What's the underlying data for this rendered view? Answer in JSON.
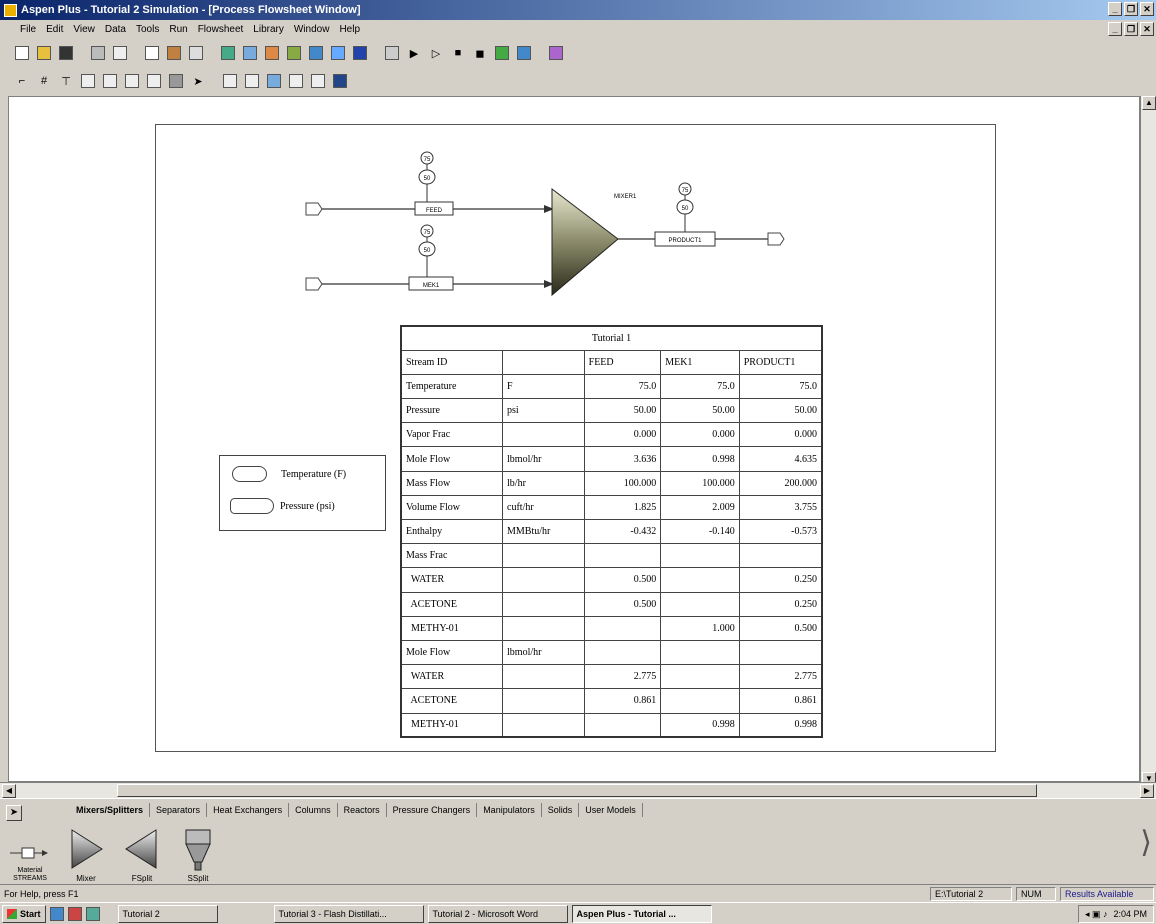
{
  "window": {
    "title": "Aspen Plus - Tutorial 2 Simulation - [Process Flowsheet Window]"
  },
  "menu": [
    "File",
    "Edit",
    "View",
    "Data",
    "Tools",
    "Run",
    "Flowsheet",
    "Library",
    "Window",
    "Help"
  ],
  "flowsheet": {
    "block_name": "MIXER1",
    "streams": [
      {
        "id": "FEED",
        "temp": "75",
        "pressure": "50"
      },
      {
        "id": "MEK1",
        "temp": "75",
        "pressure": "50"
      },
      {
        "id": "PRODUCT1",
        "temp": "75",
        "pressure": "50"
      }
    ]
  },
  "legend": {
    "temperature": "Temperature (F)",
    "pressure": "Pressure (psi)"
  },
  "results_table": {
    "title": "Tutorial 1",
    "header": [
      "Stream ID",
      "",
      "FEED",
      "MEK1",
      "PRODUCT1"
    ],
    "rows": [
      [
        "Temperature",
        "F",
        "75.0",
        "75.0",
        "75.0"
      ],
      [
        "Pressure",
        "psi",
        "50.00",
        "50.00",
        "50.00"
      ],
      [
        "Vapor Frac",
        "",
        "0.000",
        "0.000",
        "0.000"
      ],
      [
        "Mole Flow",
        "lbmol/hr",
        "3.636",
        "0.998",
        "4.635"
      ],
      [
        "Mass Flow",
        "lb/hr",
        "100.000",
        "100.000",
        "200.000"
      ],
      [
        "Volume Flow",
        "cuft/hr",
        "1.825",
        "2.009",
        "3.755"
      ],
      [
        "Enthalpy",
        "MMBtu/hr",
        "-0.432",
        "-0.140",
        "-0.573"
      ],
      [
        "Mass Frac",
        "",
        "",
        "",
        ""
      ],
      [
        "  WATER",
        "",
        "0.500",
        "",
        "0.250"
      ],
      [
        "  ACETONE",
        "",
        "0.500",
        "",
        "0.250"
      ],
      [
        "  METHY-01",
        "",
        "",
        "1.000",
        "0.500"
      ],
      [
        "Mole Flow",
        "lbmol/hr",
        "",
        "",
        ""
      ],
      [
        "  WATER",
        "",
        "2.775",
        "",
        "2.775"
      ],
      [
        "  ACETONE",
        "",
        "0.861",
        "",
        "0.861"
      ],
      [
        "  METHY-01",
        "",
        "",
        "0.998",
        "0.998"
      ]
    ]
  },
  "palette": {
    "tabs": [
      "Mixers/Splitters",
      "Separators",
      "Heat Exchangers",
      "Columns",
      "Reactors",
      "Pressure Changers",
      "Manipulators",
      "Solids",
      "User Models"
    ],
    "items": [
      "Material STREAMS",
      "Mixer",
      "FSplit",
      "SSplit"
    ]
  },
  "status": {
    "help": "For Help, press F1",
    "path": "E:\\Tutorial 2",
    "num": "NUM",
    "results": "Results Available"
  },
  "taskbar": {
    "start": "Start",
    "tasks": [
      "Tutorial 2",
      "Tutorial 3 - Flash Distillati...",
      "Tutorial 2 - Microsoft Word",
      "Aspen Plus - Tutorial ..."
    ],
    "clock": "2:04 PM"
  },
  "colors": {
    "titlebar": "#0a246a",
    "results_available": "#1a1a8a"
  }
}
